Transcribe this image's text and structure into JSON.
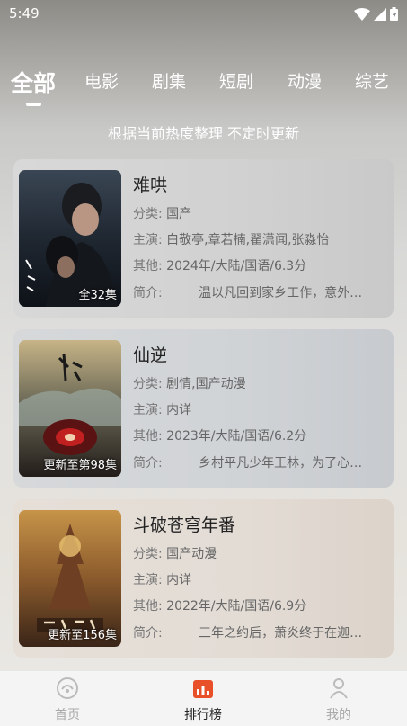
{
  "status": {
    "time": "5:49"
  },
  "tabs": [
    {
      "label": "全部"
    },
    {
      "label": "电影"
    },
    {
      "label": "剧集"
    },
    {
      "label": "短剧"
    },
    {
      "label": "动漫"
    },
    {
      "label": "综艺"
    }
  ],
  "subtitle": "根据当前热度整理 不定时更新",
  "labels": {
    "category": "分类:",
    "cast": "主演:",
    "other": "其他:",
    "intro": "简介:"
  },
  "items": [
    {
      "title": "难哄",
      "badge": "全32集",
      "category": "国产",
      "cast": "白敬亭,章若楠,翟潇闻,张淼怡",
      "other": "2024年/大陆/国语/6.3分",
      "intro": "温以凡回到家乡工作，意外遇…"
    },
    {
      "title": "仙逆",
      "badge": "更新至第98集",
      "category": "剧情,国产动漫",
      "cast": "内详",
      "other": "2023年/大陆/国语/6.2分",
      "intro": "乡村平凡少年王林，为了心中…"
    },
    {
      "title": "斗破苍穹年番",
      "badge": "更新至156集",
      "category": "国产动漫",
      "cast": "内详",
      "other": "2022年/大陆/国语/6.9分",
      "intro": "三年之约后，萧炎终于在迦南…"
    }
  ],
  "nav": [
    {
      "label": "首页",
      "icon": "home-icon"
    },
    {
      "label": "排行榜",
      "icon": "ranking-icon"
    },
    {
      "label": "我的",
      "icon": "profile-icon"
    }
  ]
}
